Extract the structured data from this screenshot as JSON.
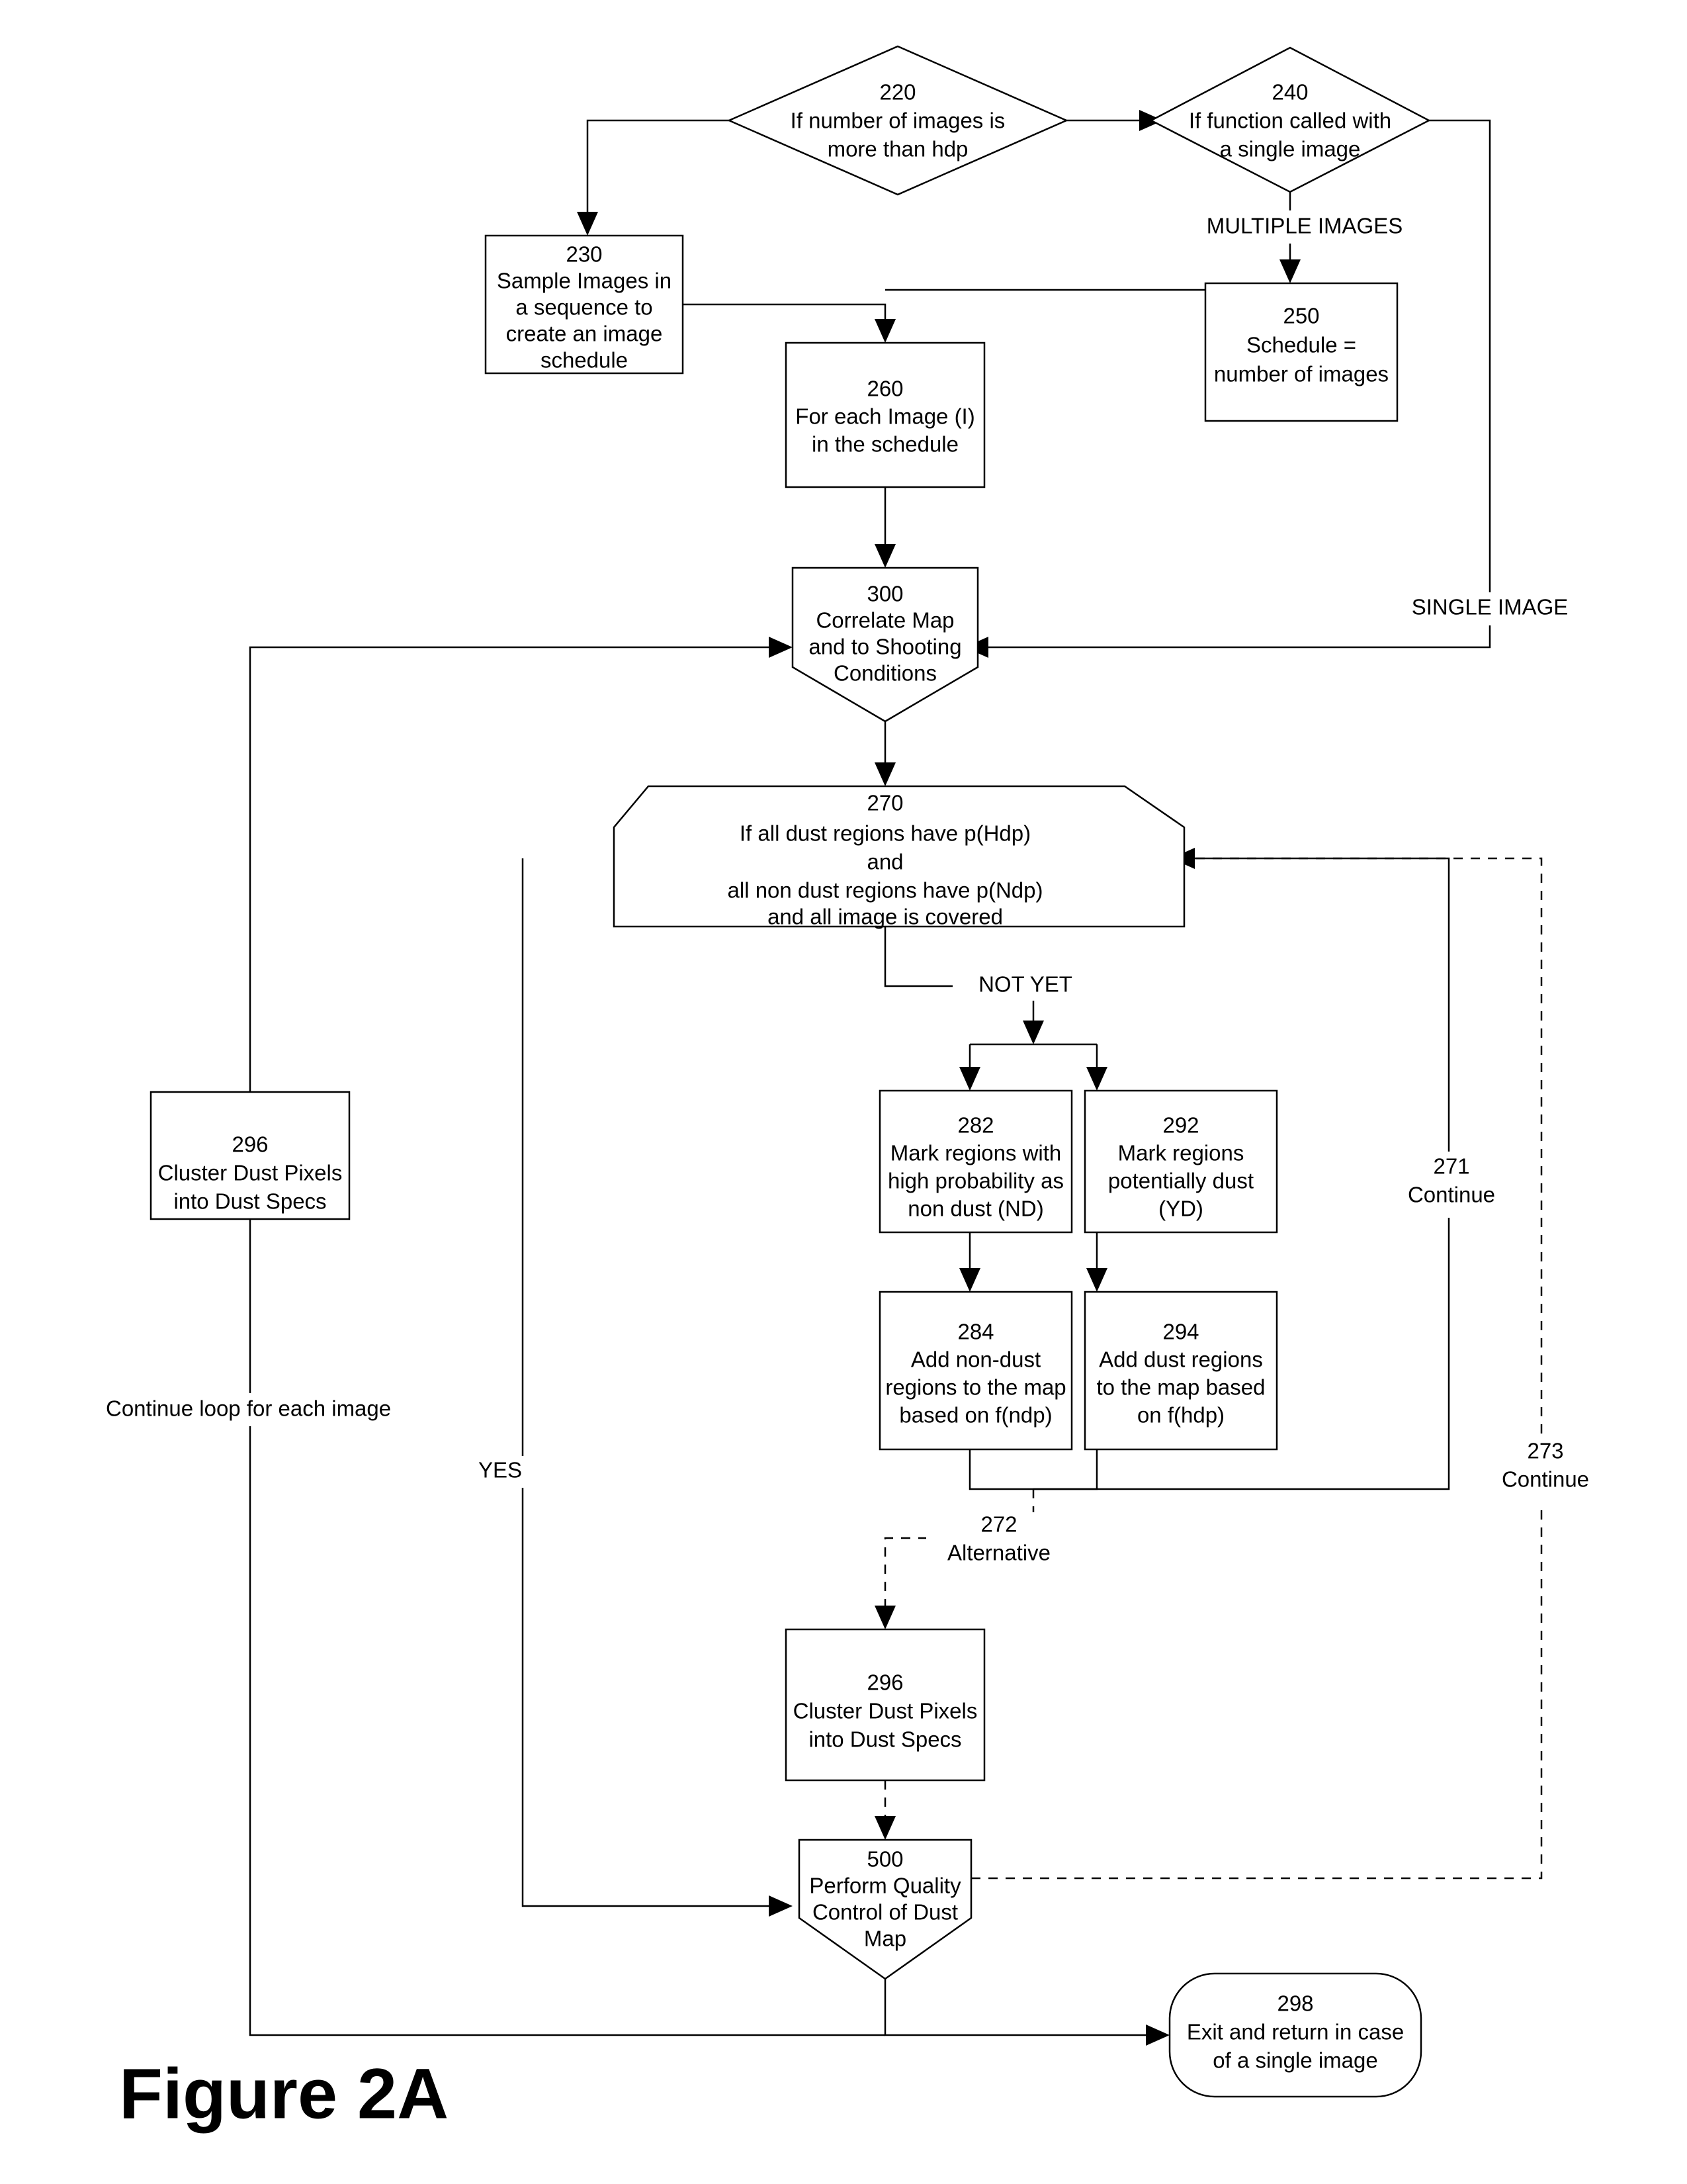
{
  "figure": {
    "caption": "Figure 2A"
  },
  "nodes": {
    "n220": {
      "id": "220",
      "lines": [
        "220",
        "If number of images is",
        "more than hdp"
      ],
      "shape": "diamond"
    },
    "n240": {
      "id": "240",
      "lines": [
        "240",
        "If function called with",
        "a single image"
      ],
      "shape": "diamond"
    },
    "n230": {
      "id": "230",
      "lines": [
        "230",
        "Sample Images in",
        "a sequence to",
        "create an image",
        "schedule"
      ],
      "shape": "rect"
    },
    "n250": {
      "id": "250",
      "lines": [
        "250",
        "Schedule =",
        "number of images"
      ],
      "shape": "rect"
    },
    "n260": {
      "id": "260",
      "lines": [
        "260",
        "For each Image (I)",
        "in the schedule"
      ],
      "shape": "rect"
    },
    "n300": {
      "id": "300",
      "lines": [
        "300",
        "Correlate Map",
        "and to Shooting",
        "Conditions"
      ],
      "shape": "pentagon-down"
    },
    "n270": {
      "id": "270",
      "lines": [
        "270",
        "If all dust regions have  p(Hdp)",
        "and",
        "all non dust regions have p(Ndp)",
        "and all image is covered"
      ],
      "shape": "cut-corner-box"
    },
    "n282": {
      "id": "282",
      "lines": [
        "282",
        "Mark regions with",
        "high probability as",
        "non dust (ND)"
      ],
      "shape": "rect"
    },
    "n292": {
      "id": "292",
      "lines": [
        "292",
        "Mark regions",
        "potentially dust",
        "(YD)"
      ],
      "shape": "rect"
    },
    "n284": {
      "id": "284",
      "lines": [
        "284",
        "Add non-dust",
        "regions to the map",
        "based on f(ndp)"
      ],
      "shape": "rect"
    },
    "n294": {
      "id": "294",
      "lines": [
        "294",
        "Add dust regions",
        "to the map based",
        "on f(hdp)"
      ],
      "shape": "rect"
    },
    "n296left": {
      "id": "296",
      "lines": [
        "296",
        "Cluster Dust Pixels",
        "into Dust Specs"
      ],
      "shape": "rect"
    },
    "n296mid": {
      "id": "296",
      "lines": [
        "296",
        "Cluster Dust Pixels",
        "into Dust Specs"
      ],
      "shape": "rect"
    },
    "n500": {
      "id": "500",
      "lines": [
        "500",
        "Perform Quality",
        "Control of Dust",
        "Map"
      ],
      "shape": "pentagon-down"
    },
    "n298": {
      "id": "298",
      "lines": [
        "298",
        "Exit and return in case",
        "of a single image"
      ],
      "shape": "rounded"
    }
  },
  "edge_labels": {
    "multiple_images": "MULTIPLE IMAGES",
    "single_image": "SINGLE IMAGE",
    "not_yet": "NOT YET",
    "yes": "YES",
    "continue_loop": "Continue loop for each image",
    "c271_num": "271",
    "c271_word": "Continue",
    "c272_num": "272",
    "c272_word": "Alternative",
    "c273_num": "273",
    "c273_word": "Continue"
  },
  "colors": {
    "stroke": "#000000",
    "fill": "#ffffff",
    "text": "#000000"
  }
}
